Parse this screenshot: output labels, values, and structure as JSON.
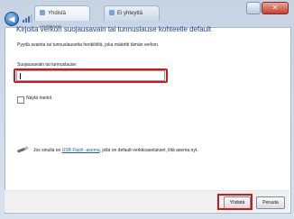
{
  "window": {
    "tab_active": "Yhdistä verkkoon",
    "tab_inactive": "Ei yhteyttä",
    "close_glyph": "✕",
    "back_glyph": "◀"
  },
  "dialog": {
    "heading": "Kirjoita verkon suojausavain tai tunnuslause kohteelle default",
    "description": "Pyydä avainta tai tunnuslausetta henkilöltä, joka määritti tämän verkon.",
    "field_label": "Suojausavain tai tunnuslause:",
    "field_value": "",
    "checkbox_label": "Näytä merkit",
    "checkbox_checked": false,
    "info_prefix": "Jos sinulla on ",
    "info_link": "USB Flash -asema",
    "info_suffix": ", jolla on default-verkkoasetukset, liitä asema nyt."
  },
  "buttons": {
    "connect": "Yhdistä",
    "cancel": "Peruuta"
  },
  "icons": {
    "back": "back-arrow-icon",
    "wireless": "wireless-network-icon",
    "usb": "usb-flash-drive-icon"
  },
  "colors": {
    "heading": "#1e3f87",
    "link": "#1a5fb4",
    "highlight": "#d21818"
  }
}
